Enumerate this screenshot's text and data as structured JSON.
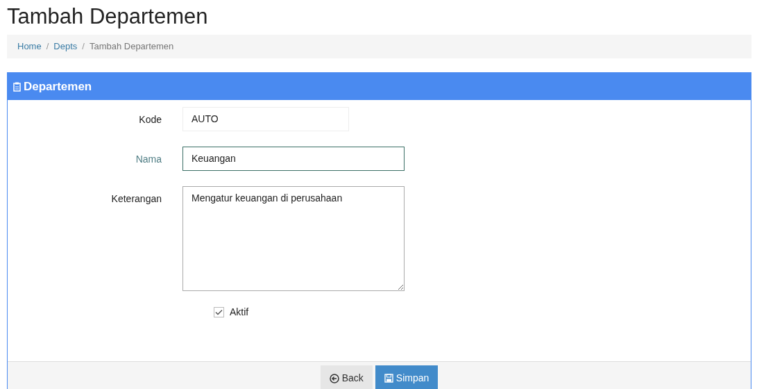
{
  "page_title": "Tambah Departemen",
  "breadcrumb": {
    "separator": "/",
    "items": [
      {
        "label": "Home",
        "link": true
      },
      {
        "label": "Depts",
        "link": true
      },
      {
        "label": "Tambah Departemen",
        "link": false
      }
    ]
  },
  "panel": {
    "title": "Departemen"
  },
  "fields": [
    {
      "label": "Kode",
      "kind": "short_input",
      "value": "AUTO",
      "readonly": true,
      "focused": false
    },
    {
      "label": "Nama",
      "kind": "input",
      "value": "Keuangan",
      "readonly": false,
      "focused": true
    },
    {
      "label": "Keterangan",
      "kind": "textarea",
      "value": "Mengatur keuangan di perusahaan",
      "focused": false
    }
  ],
  "checkbox": {
    "label": "Aktif",
    "checked": true
  },
  "buttons": [
    {
      "label": "Back",
      "kind": "back"
    },
    {
      "label": "Simpan",
      "kind": "save"
    }
  ]
}
